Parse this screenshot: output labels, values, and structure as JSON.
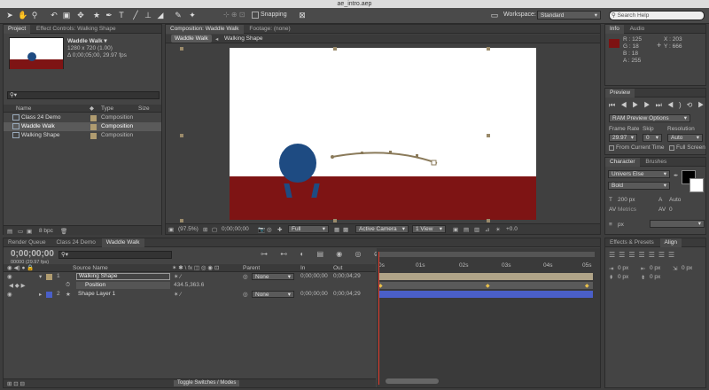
{
  "window": {
    "title": "ae_intro.aep"
  },
  "toolbar": {
    "snapping": "Snapping",
    "workspace_label": "Workspace:",
    "workspace_value": "Standard",
    "search_placeholder": "Search Help"
  },
  "project": {
    "tabs": [
      "Project",
      "Effect Controls: Walking Shape"
    ],
    "selected_name": "Waddle Walk ▾",
    "selected_dims": "1280 x 720 (1.00)",
    "selected_dur": "Δ 0;00;05;00, 29.97 fps",
    "search_placeholder": "",
    "columns": [
      "Name",
      "Type",
      "Size"
    ],
    "items": [
      {
        "name": "Class 24 Demo",
        "type": "Composition"
      },
      {
        "name": "Waddle Walk",
        "type": "Composition"
      },
      {
        "name": "Walking Shape",
        "type": "Composition"
      }
    ],
    "bpc": "8 bpc"
  },
  "composition": {
    "tabs": [
      "Composition: Waddle Walk",
      "Footage: (none)"
    ],
    "breadcrumbs": [
      "Waddle Walk",
      "Walking Shape"
    ],
    "zoom": "(97.5%)",
    "timecode": "0;00;00;00",
    "resolution": "Full",
    "camera": "Active Camera",
    "view": "1 View",
    "exposure": "+0.0",
    "colors": {
      "sky": "#ffffff",
      "ground": "#7e1414",
      "ball": "#1e4b82",
      "path": "#8a7a5a"
    }
  },
  "info": {
    "tabs": [
      "Info",
      "Audio"
    ],
    "r": "R : 125",
    "g": "G : 18",
    "b": "B : 18",
    "a": "A : 255",
    "x": "X : 203",
    "y": "Y : 666",
    "swatch": "#7d1212"
  },
  "preview": {
    "title": "Preview",
    "ram": "RAM Preview Options",
    "frame_rate_label": "Frame Rate",
    "skip_label": "Skip",
    "resolution_label": "Resolution",
    "frame_rate": "29.97",
    "skip": "0",
    "resolution": "Auto",
    "from_current": "From Current Time",
    "full_screen": "Full Screen"
  },
  "character": {
    "tabs": [
      "Character",
      "Brushes"
    ],
    "font": "Univers Else",
    "style": "Bold",
    "size": "200 px",
    "leading": "Auto",
    "metrics": "Metrics",
    "tracking": "0",
    "px_units": "px"
  },
  "effects": {
    "tabs": [
      "Effects & Presets",
      "Align"
    ],
    "values": [
      "0 px",
      "0 px",
      "0 px",
      "0 px",
      "0 px"
    ]
  },
  "timeline": {
    "tabs": [
      "Render Queue",
      "Class 24 Demo",
      "Waddle Walk"
    ],
    "timecode": "0;00;00;00",
    "timecode_sub": "00000 (29.97 fps)",
    "columns": {
      "source": "Source Name",
      "parent": "Parent",
      "in": "In",
      "out": "Out"
    },
    "layers": [
      {
        "num": "1",
        "name": "Walking Shape",
        "parent": "None",
        "in": "0;00;00;00",
        "out": "0;00;04;29"
      },
      {
        "num": "2",
        "name": "Shape Layer 1",
        "parent": "None",
        "in": "0;00;00;00",
        "out": "0;00;04;29"
      }
    ],
    "position_label": "Position",
    "position_value": "434.5,363.6",
    "ruler": [
      "0s",
      "01s",
      "02s",
      "03s",
      "04s",
      "05s"
    ],
    "toggle": "Toggle Switches / Modes"
  }
}
